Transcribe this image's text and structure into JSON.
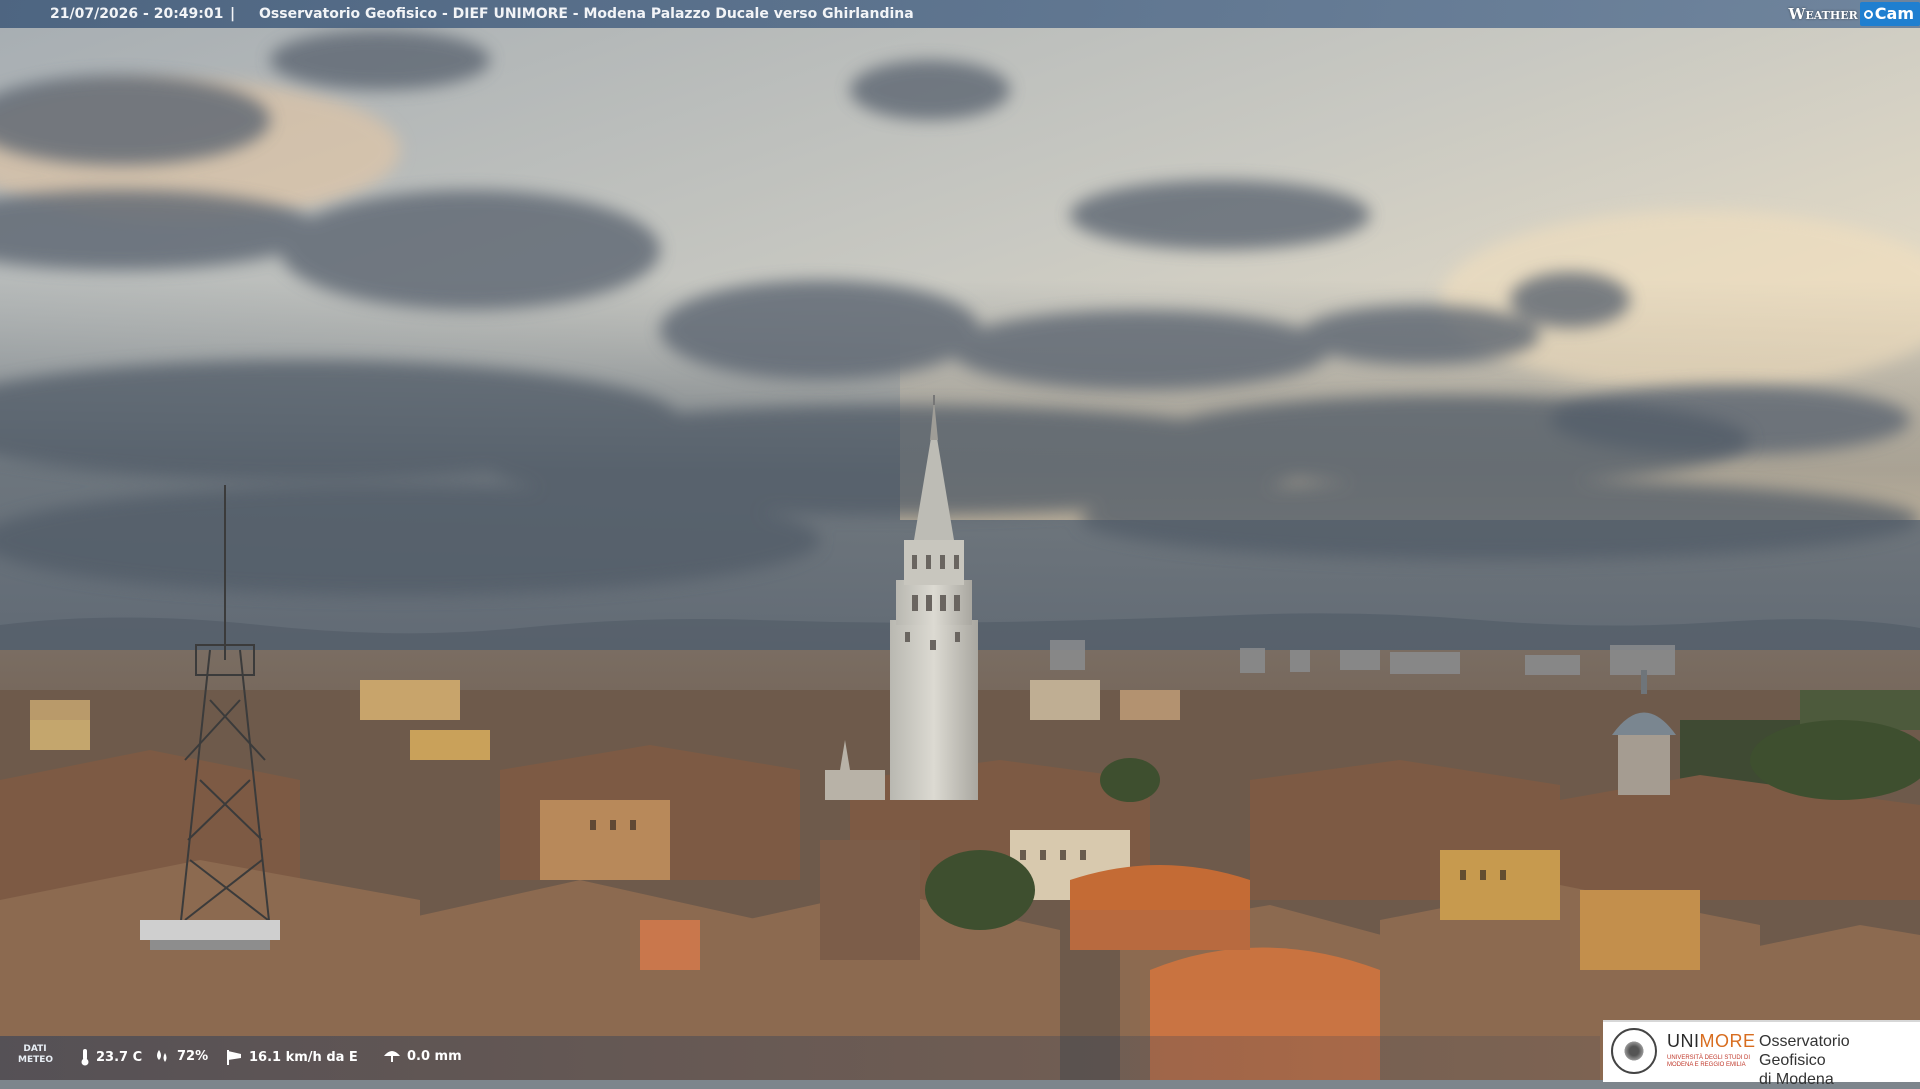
{
  "overlay": {
    "timestamp": "21/07/2026 - 20:49:01",
    "separator": "|",
    "title": "Osservatorio Geofisico - DIEF UNIMORE - Modena Palazzo Ducale verso Ghirlandina",
    "brand_weather": "Weather",
    "brand_cam": "Cam"
  },
  "weather": {
    "label_line1": "DATI",
    "label_line2": "METEO",
    "temperature": "23.7 C",
    "humidity": "72%",
    "wind": "16.1 km/h da E",
    "rain": "0.0 mm"
  },
  "logo": {
    "uni_part1": "UNI",
    "uni_part2": "MORE",
    "uni_subtitle": "UNIVERSITÀ DEGLI STUDI DI MODENA E REGGIO EMILIA",
    "observatory_line1": "Osservatorio Geofisico",
    "observatory_line2": "di Modena"
  },
  "colors": {
    "topbar": "#4f6b8c",
    "brand_blue": "#1f7fd0",
    "logo_orange": "#d86d1f"
  }
}
